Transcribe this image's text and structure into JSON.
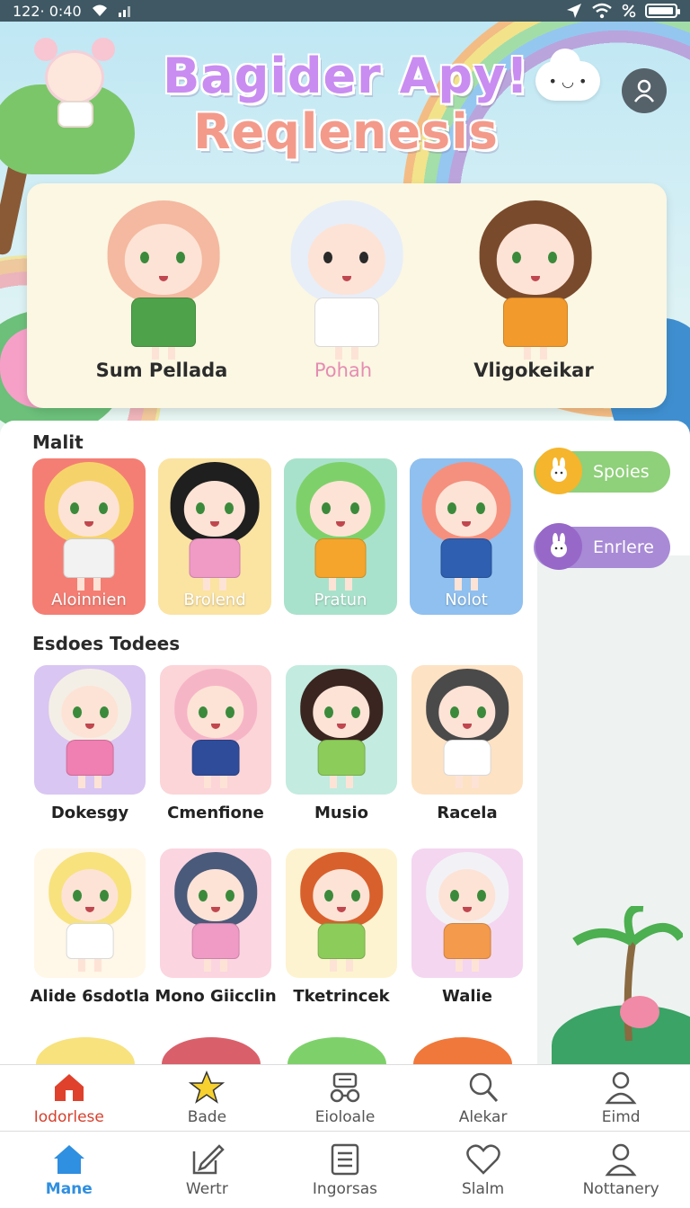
{
  "status_bar": {
    "time": "122· 0:40",
    "battery_level": 0.95
  },
  "header": {
    "title_line1": "Bagider Apy!",
    "title_line2": "Reqlenesis",
    "cloud_icon": "cloud-face-icon",
    "profile_icon": "user-icon"
  },
  "featured": {
    "characters": [
      {
        "name": "Sum Pellada",
        "hair": "#f4b9a0",
        "shirt": "#4ea34a",
        "eyes": "#3b8a3b"
      },
      {
        "name": "Pohah",
        "hair": "#e7eef8",
        "shirt": "#ffffff",
        "eyes": "#2a2a2a"
      },
      {
        "name": "Vligokeikar",
        "hair": "#7a4a2c",
        "shirt": "#f39a2c",
        "eyes": "#3b8a3b"
      }
    ]
  },
  "section1": {
    "title": "Malit",
    "cards": [
      {
        "name": "Aloinnien",
        "bg": "#f47e74",
        "hair": "#f6d36a",
        "shirt": "#f2f2f2"
      },
      {
        "name": "Brolend",
        "bg": "#fbe3a2",
        "hair": "#1f1f1f",
        "shirt": "#f09ac6"
      },
      {
        "name": "Pratun",
        "bg": "#a9e2cc",
        "hair": "#7ed16a",
        "shirt": "#f5a52c"
      },
      {
        "name": "Nolot",
        "bg": "#8fc0ef",
        "hair": "#f5907e",
        "shirt": "#2f5fb0"
      }
    ]
  },
  "side_buttons": [
    {
      "label": "Spoies",
      "color": "#8fd07a",
      "badge": "#f5b52c",
      "icon": "bunny-icon"
    },
    {
      "label": "Enrlere",
      "color": "#a88ad6",
      "badge": "#9768c8",
      "icon": "bunny-icon"
    }
  ],
  "section2": {
    "title": "Esdoes Todees",
    "tiles": [
      {
        "name": "Dokesgy",
        "bg": "#d9c6f2",
        "hair": "#f4efe6",
        "shirt": "#f07fb2"
      },
      {
        "name": "Cmenfione",
        "bg": "#fbd5d8",
        "hair": "#f6b5c6",
        "shirt": "#2f4c9a"
      },
      {
        "name": "Musio",
        "bg": "#c3ebe0",
        "hair": "#3a2520",
        "shirt": "#8ccc5a"
      },
      {
        "name": "Racela",
        "bg": "#fde2c4",
        "hair": "#4a4a4a",
        "shirt": "#ffffff"
      },
      {
        "name": "Alide 6sdotla",
        "bg": "#fff7e8",
        "hair": "#f7e27e",
        "shirt": "#ffffff"
      },
      {
        "name": "Mono Giicclin",
        "bg": "#fbd5e0",
        "hair": "#4a5a7a",
        "shirt": "#f09ac6"
      },
      {
        "name": "Tketrincek",
        "bg": "#fdf3d0",
        "hair": "#d8602c",
        "shirt": "#8ccc5a"
      },
      {
        "name": "Walie",
        "bg": "#f4d6f0",
        "hair": "#f2f2f6",
        "shirt": "#f39a4c"
      }
    ]
  },
  "nav_top": [
    {
      "label": "Iodorlese",
      "icon": "house-icon"
    },
    {
      "label": "Bade",
      "icon": "star-icon"
    },
    {
      "label": "Eioloale",
      "icon": "gamepad-icon"
    },
    {
      "label": "Alekar",
      "icon": "search-icon"
    },
    {
      "label": "Eimd",
      "icon": "person-icon"
    }
  ],
  "nav_bottom": [
    {
      "label": "Mane",
      "icon": "home-icon"
    },
    {
      "label": "Wertr",
      "icon": "edit-icon"
    },
    {
      "label": "Ingorsas",
      "icon": "list-icon"
    },
    {
      "label": "Slalm",
      "icon": "heart-icon"
    },
    {
      "label": "Nottanery",
      "icon": "profile-icon"
    }
  ]
}
